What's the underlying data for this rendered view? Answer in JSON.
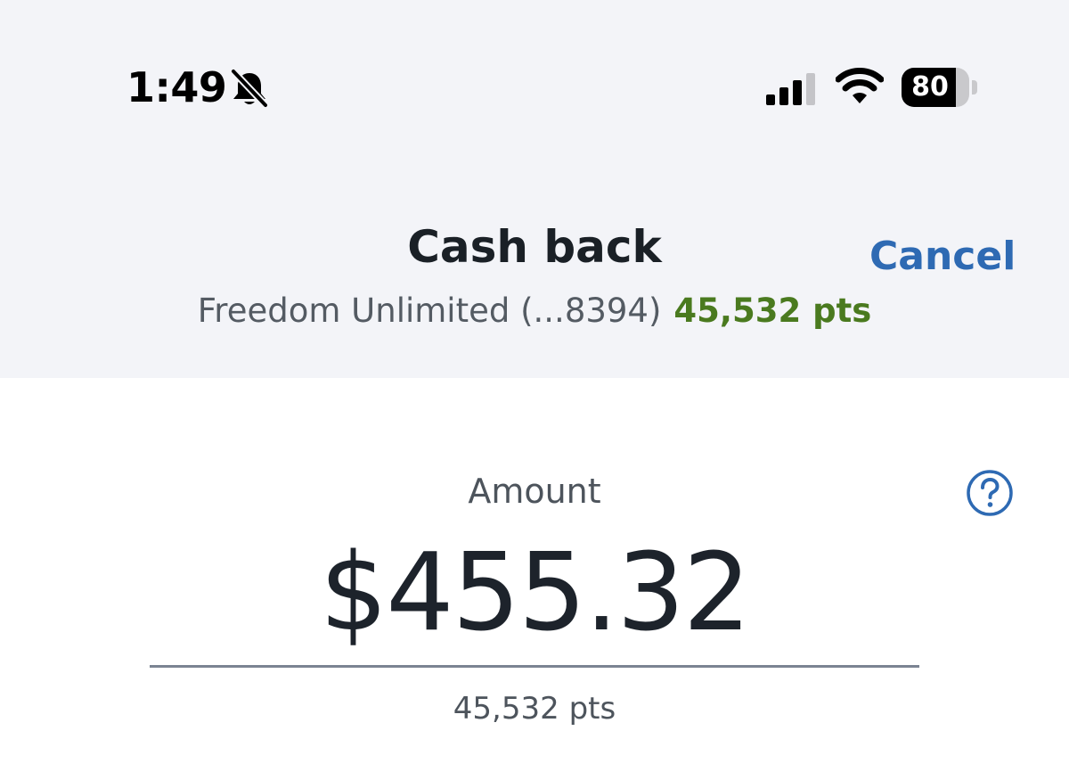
{
  "status_bar": {
    "time": "1:49",
    "mute_icon": "bell-slash-icon",
    "signal_icon": "cellular-signal-icon",
    "wifi_icon": "wifi-icon",
    "battery_percent": "80",
    "battery_level": 0.8
  },
  "header": {
    "title": "Cash back",
    "cancel_label": "Cancel",
    "account_name": "Freedom Unlimited (...8394)",
    "points_balance": "45,532 pts"
  },
  "amount": {
    "label": "Amount",
    "value": "$455.32",
    "points": "45,532 pts",
    "help_icon": "question-circle-icon"
  },
  "colors": {
    "accent_blue": "#2e6ab3",
    "points_green": "#4a7a1f",
    "header_bg": "#f3f4f8"
  }
}
